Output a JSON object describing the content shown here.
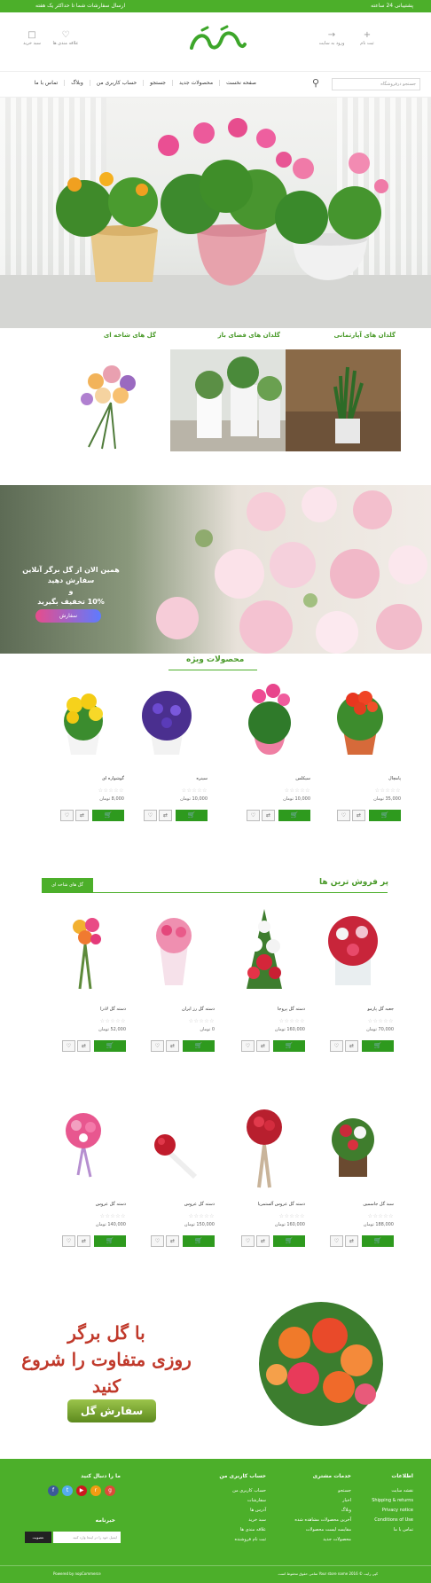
{
  "topbar": {
    "support": "پشتیبانی 24 ساعته",
    "shipping": "ارسال سفارشات شما تا حداکثر یک هفته"
  },
  "header": {
    "register": "ثبت نام",
    "login": "ورود به سایت",
    "wishlist": "علاقه مندی ها",
    "cart": "سبد خرید",
    "logo_text": "گل برگر"
  },
  "nav": {
    "search_placeholder": "جستجو درفروشگاه",
    "menu": [
      "صفحه نخست",
      "محصولات جدید",
      "جستجو",
      "حساب کاربری من",
      "وبلاگ",
      "تماس با ما"
    ]
  },
  "categories": [
    {
      "title": "گلدان های آپارتمانی"
    },
    {
      "title": "گلدان های فضای باز"
    },
    {
      "title": "گل های شاخه ای"
    }
  ],
  "banner": {
    "text_line1": "همین الان از گل برگر آنلاین سفارش دهید",
    "text_line2": "و",
    "text_line3": "10% تخفیف بگیرید",
    "button": "سفارش"
  },
  "featured": {
    "title": "محصولات ویژه",
    "products": [
      {
        "name": "پامچال",
        "price": "35,000 تومان"
      },
      {
        "name": "سیکلمن",
        "price": "10,000 تومان"
      },
      {
        "name": "سینره",
        "price": "10,000 تومان"
      },
      {
        "name": "گوشواره ای",
        "price": "8,000 تومان"
      }
    ]
  },
  "bestsellers": {
    "title": "پر فروش ترین ها",
    "tab": "گل های شاخه ای",
    "row1": [
      {
        "name": "جعبه گل پارمو",
        "price": "70,000 تومان"
      },
      {
        "name": "دسته گل پروجا",
        "price": "160,000 تومان"
      },
      {
        "name": "دسته گل رز ایران",
        "price": "0 تومان"
      },
      {
        "name": "دسته گل لادرا",
        "price": "52,000 تومان"
      }
    ],
    "row2": [
      {
        "name": "سبد گل جاسمین",
        "price": "188,000 تومان"
      },
      {
        "name": "دسته گل عروس آلستمریا",
        "price": "160,000 تومان"
      },
      {
        "name": "دسته گل عروس",
        "price": "150,000 تومان"
      },
      {
        "name": "دسته گل عروس",
        "price": "140,000 تومان"
      }
    ]
  },
  "promo": {
    "line1": "با گل برگر",
    "line2": "روزی متفاوت را شروع کنید",
    "button": "سفارش گل"
  },
  "footer": {
    "info_title": "اطلاعات",
    "info_items": [
      "نقشه سایت",
      "Shipping & returns",
      "Privacy notice",
      "Conditions of Use",
      "تماس با ما"
    ],
    "services_title": "خدمات مشتری",
    "services_items": [
      "جستجو",
      "اخبار",
      "وبلاگ",
      "آخرین محصولات مشاهده شده",
      "مقایسه لیست محصولات",
      "محصولات جدید"
    ],
    "account_title": "حساب کاربری من",
    "account_items": [
      "حساب کاربری من",
      "سفارشات",
      "آدرس ها",
      "سبد خرید",
      "علاقه مندی ها",
      "ثبت نام فروشنده"
    ],
    "follow_title": "ما را دنبال کنید",
    "newsletter_title": "خبرنامه",
    "newsletter_placeholder": "ایمیل خود را در اینجا وارد کنید",
    "newsletter_button": "عضویت",
    "copyright": "کپی رایت © 2016 Your store name تمامی حقوق محفوظ است.",
    "powered": "Powered by nopCommerce"
  }
}
